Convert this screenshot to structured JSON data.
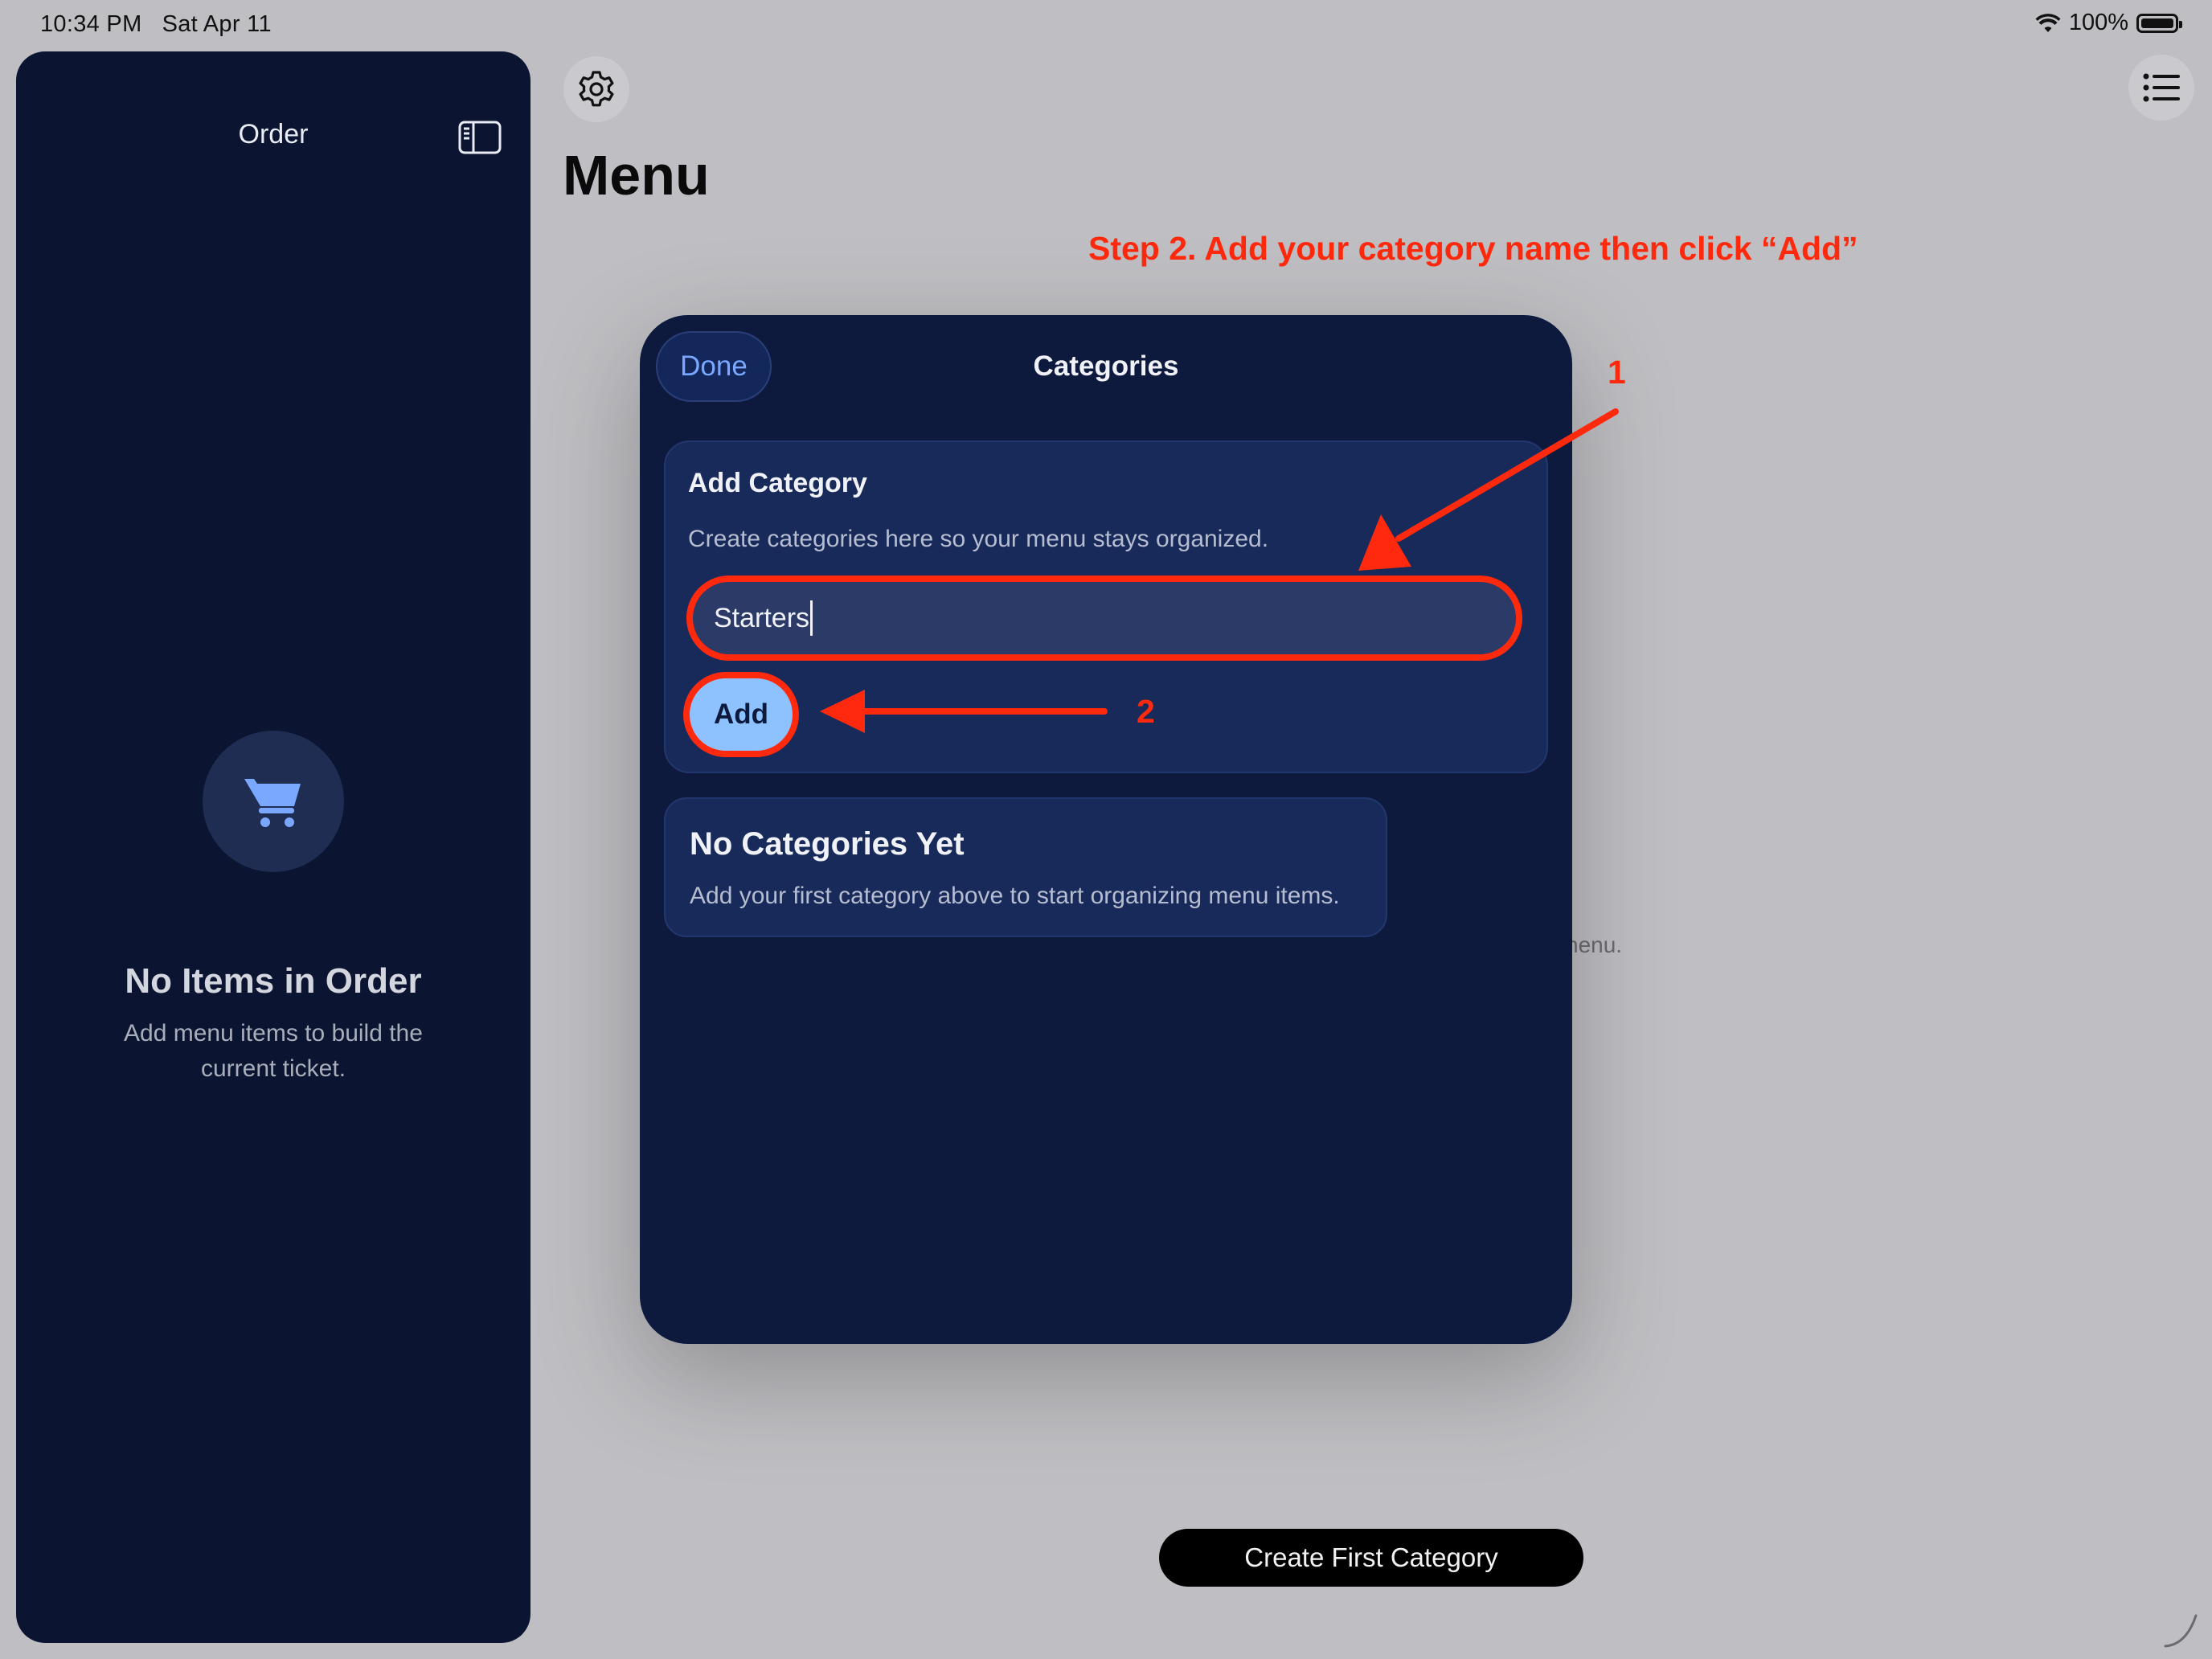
{
  "status_bar": {
    "time": "10:34 PM   Sat Apr 11",
    "battery": "100%"
  },
  "sidebar": {
    "title": "Order",
    "empty_title": "No Items in Order",
    "empty_subtitle": "Add menu items to build the current ticket."
  },
  "main": {
    "title": "Menu",
    "background_peek_text": "nenu.",
    "create_first_button": "Create First Category"
  },
  "instruction": {
    "text": "Step 2. Add your category name then click “Add”",
    "marker_1": "1",
    "marker_2": "2"
  },
  "modal": {
    "done_label": "Done",
    "title": "Categories",
    "add_card": {
      "title": "Add Category",
      "description": "Create categories here so your menu stays organized.",
      "input_value": "Starters",
      "add_label": "Add"
    },
    "empty_card": {
      "title": "No Categories Yet",
      "subtitle": "Add your first category above to start organizing menu items."
    }
  },
  "colors": {
    "annotation": "#ff2a0e",
    "sidebar_bg": "#0b1430",
    "modal_bg": "#0d1a3d",
    "card_bg": "#182a5a",
    "accent": "#8ec2ff"
  },
  "icons": [
    "wifi-icon",
    "battery-icon",
    "sidebar-toggle-icon",
    "cart-icon",
    "gear-icon",
    "list-icon"
  ]
}
